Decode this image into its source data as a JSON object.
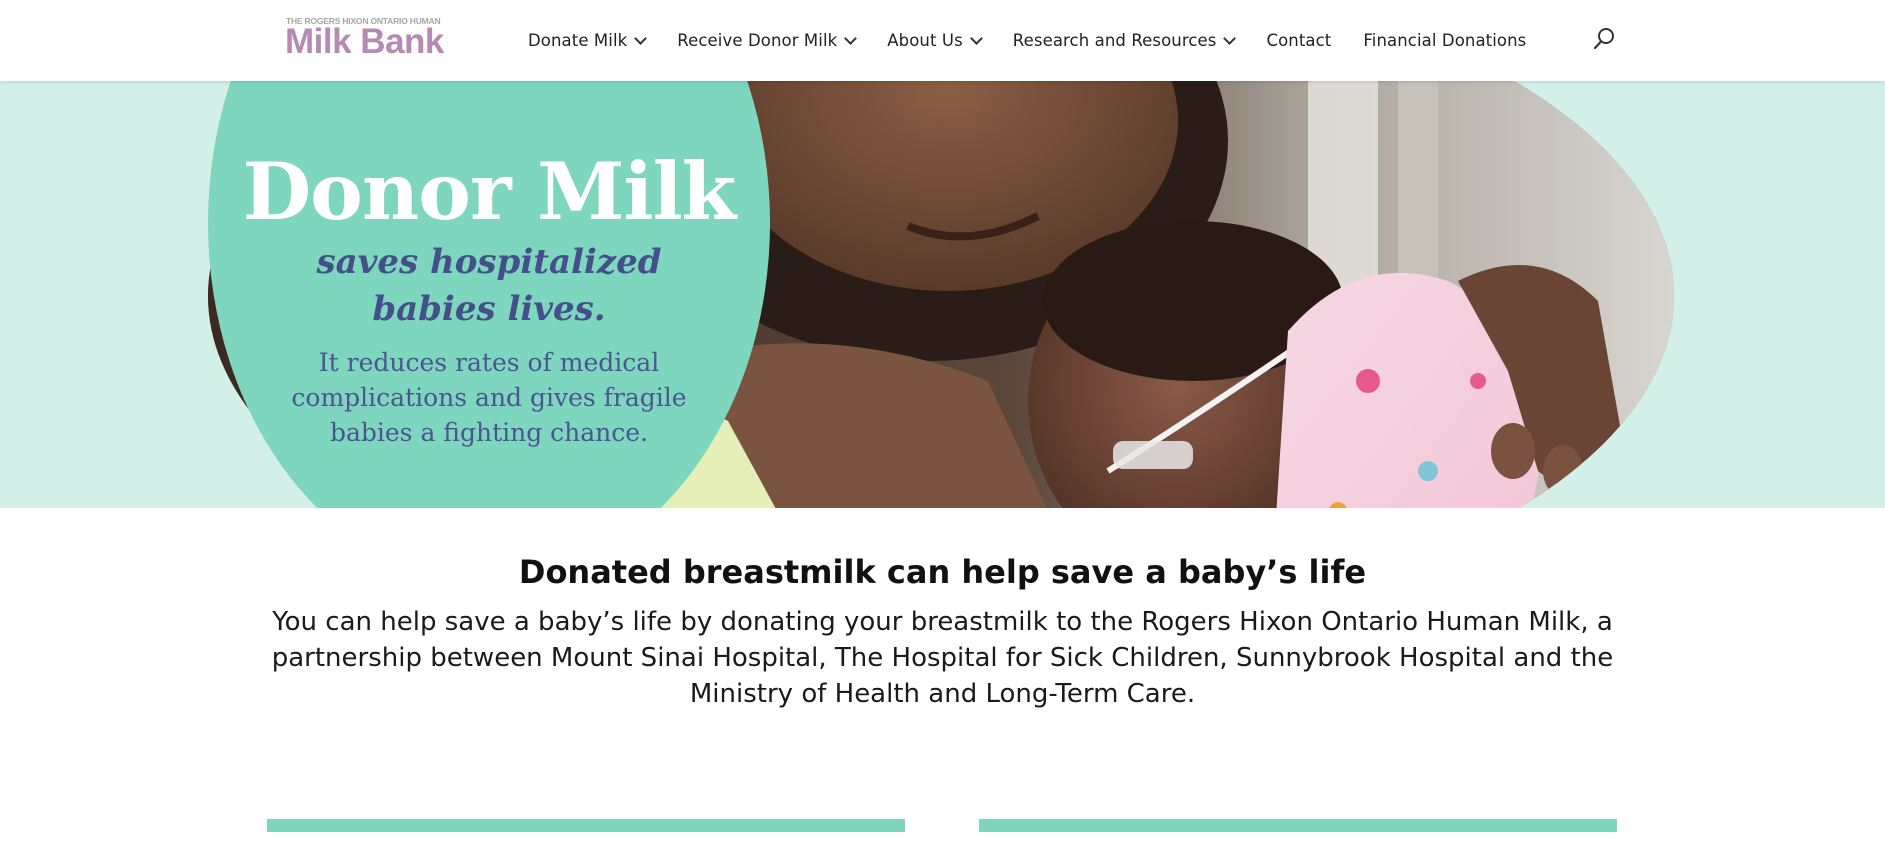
{
  "header": {
    "logo_small": "THE ROGERS HIXON ONTARIO HUMAN",
    "logo_big": "Milk Bank",
    "nav": [
      {
        "label": "Donate Milk",
        "has_dropdown": true
      },
      {
        "label": "Receive Donor Milk",
        "has_dropdown": true
      },
      {
        "label": "About Us",
        "has_dropdown": true
      },
      {
        "label": "Research and Resources",
        "has_dropdown": true
      },
      {
        "label": "Contact",
        "has_dropdown": false
      },
      {
        "label": "Financial Donations",
        "has_dropdown": false
      }
    ],
    "search_icon": "search-icon"
  },
  "hero": {
    "title": "Donor Milk",
    "subtitle_line1": "saves hospitalized",
    "subtitle_line2": "babies lives.",
    "body": "It reduces rates of medical complications and gives fragile babies a fighting chance."
  },
  "main": {
    "headline": "Donated breastmilk can help save a baby’s life",
    "intro": "You can help save a baby’s life by donating your breastmilk to the Rogers Hixon Ontario Human Milk, a partnership between Mount Sinai Hospital, The Hospital for Sick Children, Sunnybrook Hospital and the Ministry of Health and Long-Term Care."
  },
  "colors": {
    "accent_green": "#7dd6bd",
    "hero_bg": "#d2f0e8",
    "logo_purple": "#b58ab4",
    "hero_text_blue": "#44508a"
  }
}
